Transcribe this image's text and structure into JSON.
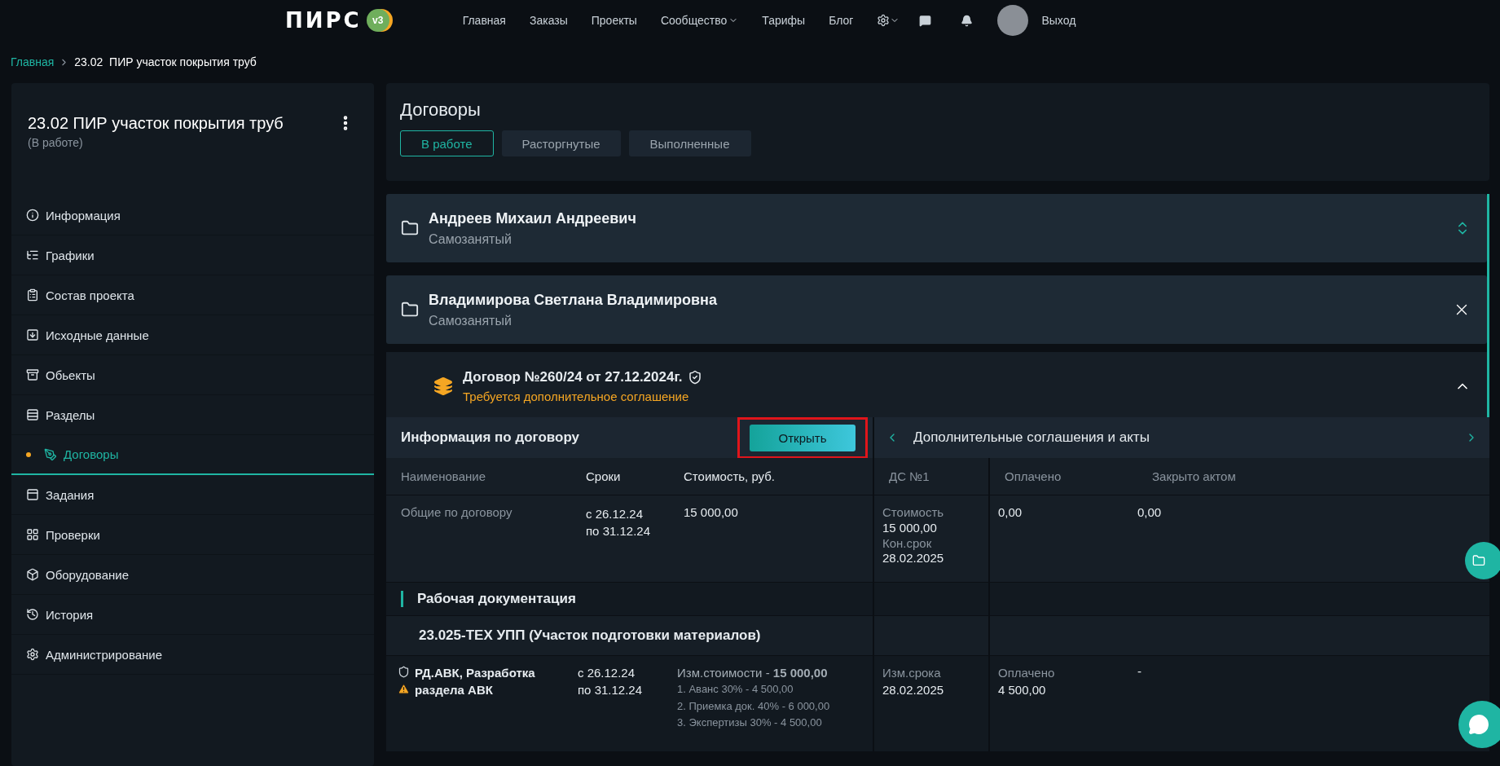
{
  "header": {
    "logo": "ПИРС",
    "logo_badge": "v3",
    "nav": [
      {
        "label": "Главная",
        "dropdown": false
      },
      {
        "label": "Заказы",
        "dropdown": false
      },
      {
        "label": "Проекты",
        "dropdown": false
      },
      {
        "label": "Сообщество",
        "dropdown": true
      },
      {
        "label": "Тарифы",
        "dropdown": false
      },
      {
        "label": "Блог",
        "dropdown": false
      }
    ],
    "logout": "Выход"
  },
  "breadcrumb": [
    "Главная",
    "23.02  ПИР участок покрытия труб"
  ],
  "project": {
    "title": "23.02 ПИР участок покрытия труб",
    "status": "(В работе)"
  },
  "sidebar": {
    "items": [
      {
        "label": "Информация",
        "selected": false
      },
      {
        "label": "Графики",
        "selected": false
      },
      {
        "label": "Состав проекта",
        "selected": false
      },
      {
        "label": "Исходные данные",
        "selected": false
      },
      {
        "label": "Обьекты",
        "selected": false
      },
      {
        "label": "Разделы",
        "selected": false
      },
      {
        "label": "Договоры",
        "selected": true
      },
      {
        "label": "Задания",
        "selected": false
      },
      {
        "label": "Проверки",
        "selected": false
      },
      {
        "label": "Оборудование",
        "selected": false
      },
      {
        "label": "История",
        "selected": false
      },
      {
        "label": "Администрирование",
        "selected": false
      }
    ]
  },
  "contracts": {
    "title": "Договоры",
    "tabs": [
      {
        "label": "В работе",
        "selected": true
      },
      {
        "label": "Расторгнутые",
        "selected": false
      },
      {
        "label": "Выполненные",
        "selected": false
      }
    ],
    "persons": [
      {
        "name": "Андреев Михаил Андреевич",
        "role": "Самозанятый",
        "expanded": false
      },
      {
        "name": "Владимирова  Светлана Владимировна",
        "role": "Самозанятый",
        "expanded": true
      }
    ],
    "contract": {
      "title": "Договор №260/24 от 27.12.2024г.",
      "warning": "Требуется дополнительное соглашение",
      "expanded": true
    },
    "info": {
      "title": "Информация по договору",
      "open_button": "Открыть",
      "highlighted": true,
      "agreements_title": "Дополнительные соглашения и акты",
      "columns": [
        "Наименование",
        "Сроки",
        "Стоимость, руб.",
        "ДС №1",
        "Оплачено",
        "Закрыто актом"
      ],
      "general": {
        "name": "Общие по договору",
        "term": [
          "с 26.12.24",
          "по 31.12.24"
        ],
        "cost": "15 000,00",
        "ds": [
          "Стоимость",
          "15 000,00",
          "Кон.срок",
          "28.02.2025"
        ],
        "paid": "0,00",
        "closed": "0,00"
      },
      "section": "Рабочая документация",
      "group": "23.025-ТЕХ УПП (Участок подготовки материалов)",
      "item": {
        "name": "РД.АВК, Разработка раздела АВК",
        "term": [
          "с 26.12.24",
          "по 31.12.24"
        ],
        "cost": "Изм.стоимости - **15 000,00**",
        "stages": [
          "1. Аванс 30% - 4 500,00",
          "2. Приемка док. 40% - 6 000,00",
          "3. Экспертизы 30% - 4 500,00"
        ],
        "ds": [
          "Изм.срока",
          "28.02.2025"
        ],
        "paid": [
          "Оплачено",
          "4 500,00"
        ],
        "closed": "-"
      }
    }
  }
}
